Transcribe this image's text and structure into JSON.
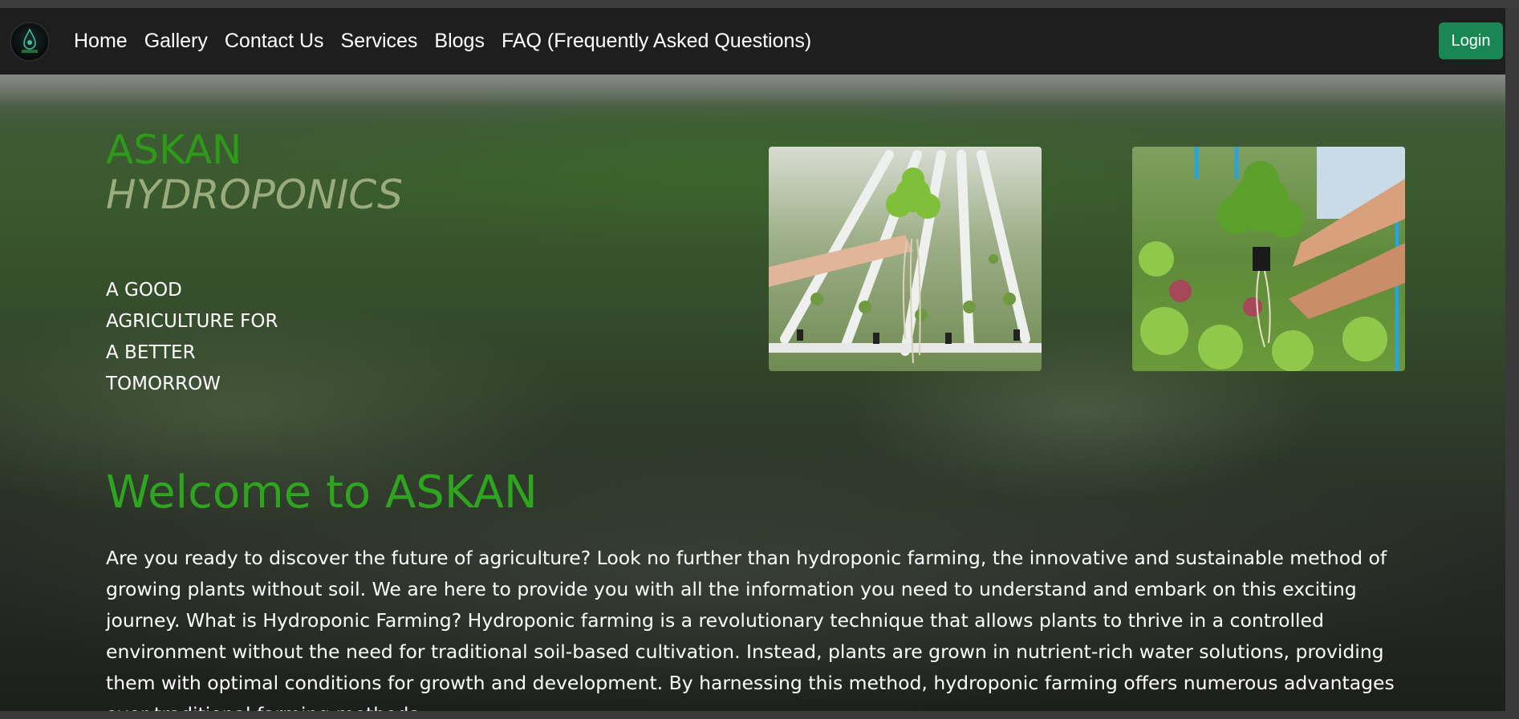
{
  "nav": {
    "logo_alt": "ASKAN",
    "links": [
      "Home",
      "Gallery",
      "Contact Us",
      "Services",
      "Blogs",
      "FAQ (Frequently Asked Questions)"
    ],
    "login_label": "Login"
  },
  "hero": {
    "brand_line1": "ASKAN",
    "brand_line2": "HYDROPONICS",
    "tagline_lines": [
      "A GOOD",
      "AGRICULTURE FOR",
      "A BETTER",
      "TOMORROW"
    ],
    "welcome_title": "Welcome to ASKAN",
    "intro_text": "Are you ready to discover the future of agriculture? Look no further than hydroponic farming, the innovative and sustainable method of growing plants without soil. We are here to provide you with all the information you need to understand and embark on this exciting journey. What is Hydroponic Farming? Hydroponic farming is a revolutionary technique that allows plants to thrive in a controlled environment without the need for traditional soil-based cultivation. Instead, plants are grown in nutrient-rich water solutions, providing them with optimal conditions for growth and development. By harnessing this method, hydroponic farming offers numerous advantages over traditional farming methods."
  },
  "colors": {
    "navbar_bg": "#1e1e1e",
    "login_bg": "#198754",
    "brand_green": "#2e9a1a",
    "brand_olive": "#9aab7e",
    "welcome_green": "#2ea51f"
  }
}
